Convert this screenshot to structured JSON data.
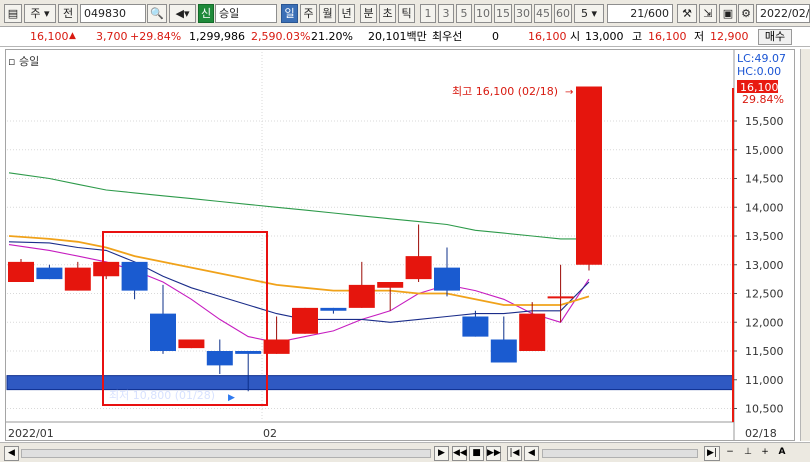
{
  "toolbar": {
    "jong_label": "주",
    "jeon_label": "전",
    "stock_code": "049830",
    "sin_label": "신",
    "stock_name": "승일",
    "periods": [
      "일",
      "주",
      "월",
      "년",
      "분",
      "초",
      "틱"
    ],
    "intervals": [
      "1",
      "3",
      "5",
      "10",
      "15",
      "30",
      "45",
      "60"
    ],
    "count_select": "5",
    "page_counter": "21/600",
    "date_field": "2022/02/"
  },
  "quote": {
    "price": "16,100",
    "change": "3,700",
    "change_pct": "+29.84%",
    "volume": "1,299,986",
    "volume_pct": "2,590.03%",
    "turnover_pct": "21.20%",
    "amount": "20,101백만",
    "best_label": "최우선",
    "best_value": "0",
    "last": "16,100",
    "open_label": "시",
    "open": "13,000",
    "high_label": "고",
    "high": "16,100",
    "low_label": "저",
    "low": "12,900",
    "buy_label": "매수"
  },
  "chart_title": "승일",
  "chart_labels": {
    "lc": "LC:49.07",
    "hc": "HC:0.00",
    "price_tag": "16,100",
    "pct_tag": "29.84%",
    "high_note": "최고 16,100 (02/18)",
    "low_note": "최저 10,800 (01/28)"
  },
  "chart_data": {
    "type": "candlestick",
    "title": "승일",
    "ylim": [
      10300,
      16700
    ],
    "y_ticks": [
      10500,
      11000,
      11500,
      12000,
      12500,
      13000,
      13500,
      14000,
      14500,
      15000,
      15500
    ],
    "y_tick_labels": [
      "10,500",
      "11,000",
      "11,500",
      "12,000",
      "12,500",
      "13,000",
      "13,500",
      "14,000",
      "14,500",
      "15,000",
      "15,500"
    ],
    "x_labels": [
      "2022/01",
      "02",
      "02/18"
    ],
    "candles": [
      {
        "o": 12700,
        "h": 13100,
        "l": 12700,
        "c": 13050
      },
      {
        "o": 12950,
        "h": 13000,
        "l": 12750,
        "c": 12750
      },
      {
        "o": 12550,
        "h": 13050,
        "l": 12550,
        "c": 12950
      },
      {
        "o": 12800,
        "h": 13050,
        "l": 12750,
        "c": 13050
      },
      {
        "o": 13050,
        "h": 13050,
        "l": 12400,
        "c": 12550
      },
      {
        "o": 12150,
        "h": 12650,
        "l": 11450,
        "c": 11500
      },
      {
        "o": 11550,
        "h": 11700,
        "l": 11550,
        "c": 11700
      },
      {
        "o": 11500,
        "h": 11700,
        "l": 11100,
        "c": 11250
      },
      {
        "o": 11500,
        "h": 11500,
        "l": 10800,
        "c": 11450
      },
      {
        "o": 11450,
        "h": 12100,
        "l": 11450,
        "c": 11700
      },
      {
        "o": 11800,
        "h": 12250,
        "l": 11800,
        "c": 12250
      },
      {
        "o": 12250,
        "h": 12250,
        "l": 12150,
        "c": 12200
      },
      {
        "o": 12250,
        "h": 13050,
        "l": 12250,
        "c": 12650
      },
      {
        "o": 12600,
        "h": 12650,
        "l": 12200,
        "c": 12700
      },
      {
        "o": 12750,
        "h": 13700,
        "l": 12700,
        "c": 13150
      },
      {
        "o": 12950,
        "h": 13300,
        "l": 12450,
        "c": 12550
      },
      {
        "o": 12100,
        "h": 12200,
        "l": 11750,
        "c": 11750
      },
      {
        "o": 11700,
        "h": 12100,
        "l": 11300,
        "c": 11300
      },
      {
        "o": 11500,
        "h": 12350,
        "l": 11500,
        "c": 12150
      },
      {
        "o": 12450,
        "h": 13000,
        "l": 12000,
        "c": 12450
      },
      {
        "o": 13000,
        "h": 16100,
        "l": 12900,
        "c": 16100
      }
    ],
    "ma": [
      {
        "color": "#c61dc0",
        "values": [
          13350,
          13250,
          13150,
          13050,
          12900,
          12700,
          12400,
          12050,
          11750,
          11650,
          11750,
          11850,
          12050,
          12200,
          12500,
          12650,
          12550,
          12400,
          12150,
          12000,
          12750
        ]
      },
      {
        "color": "#1b2d8a",
        "values": [
          13400,
          13380,
          13300,
          13250,
          13050,
          12800,
          12600,
          12450,
          12300,
          12150,
          12050,
          12050,
          12050,
          12000,
          12050,
          12100,
          12150,
          12150,
          12200,
          12200,
          12700
        ]
      },
      {
        "color": "#f0a21a",
        "values": [
          13500,
          13450,
          13400,
          13300,
          13150,
          13050,
          12950,
          12850,
          12750,
          12650,
          12600,
          12550,
          12550,
          12550,
          12500,
          12500,
          12400,
          12300,
          12300,
          12300,
          12450
        ]
      },
      {
        "color": "#2d9a4a",
        "values": [
          14600,
          14500,
          14400,
          14300,
          14250,
          14200,
          14150,
          14100,
          14050,
          14000,
          13950,
          13900,
          13850,
          13800,
          13750,
          13700,
          13600,
          13550,
          13500,
          13450,
          13450
        ]
      }
    ],
    "hline": {
      "value": 10950,
      "color": "#2f59c2"
    }
  }
}
